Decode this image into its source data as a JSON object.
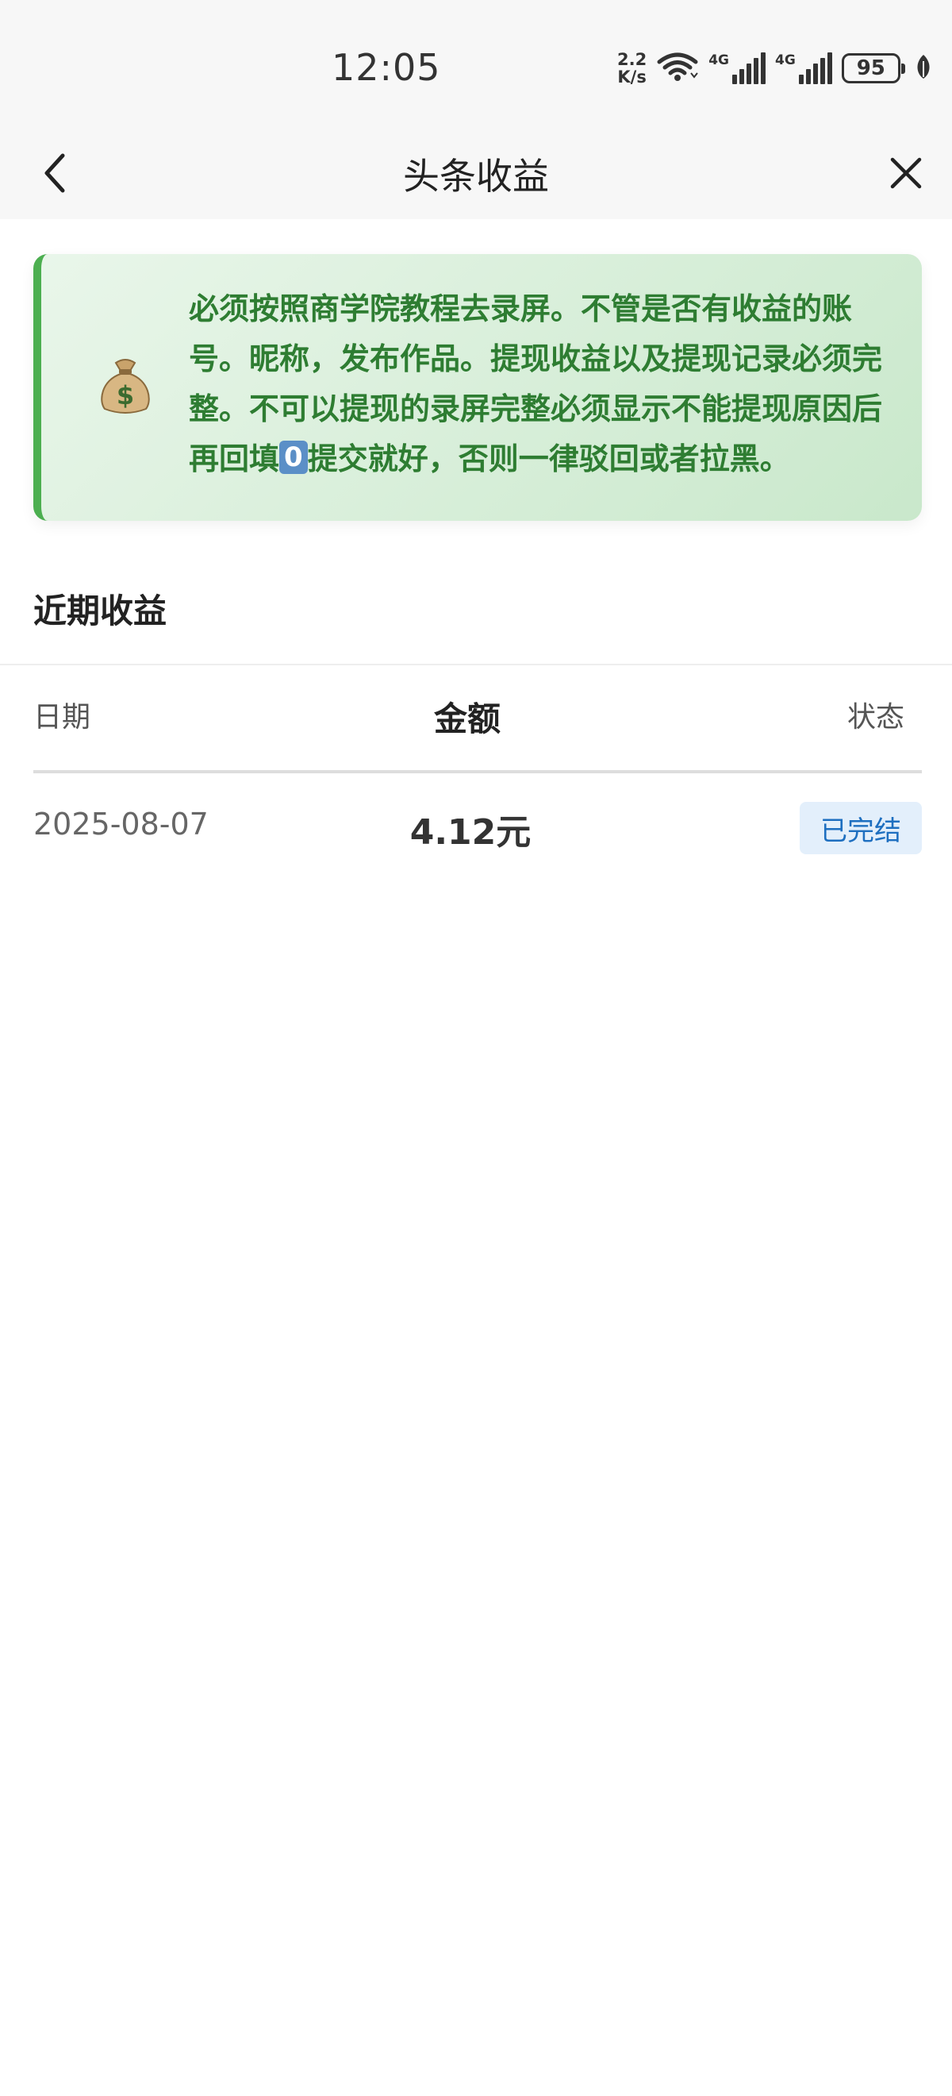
{
  "status_bar": {
    "time": "12:05",
    "net_speed_value": "2.2",
    "net_speed_unit": "K/s",
    "signal_label_1": "4G",
    "signal_label_2": "4G",
    "battery": "95",
    "icons": [
      "wifi-icon",
      "signal-icon",
      "signal-icon",
      "battery-icon",
      "leaf-icon"
    ]
  },
  "nav": {
    "title": "头条收益",
    "back_icon": "chevron-left-icon",
    "close_icon": "close-icon"
  },
  "notice": {
    "icon": "money-bag-icon",
    "text_before": "必须按照商学院教程去录屏。不管是否有收益的账号。昵称，发布作品。提现收益以及提现记录必须完整。不可以提现的录屏完整必须显示不能提现原因后再回填",
    "badge": "0",
    "text_after": "提交就好，否则一律驳回或者拉黑。"
  },
  "section": {
    "title": "近期收益"
  },
  "table": {
    "headers": {
      "date": "日期",
      "amount": "金额",
      "status": "状态"
    },
    "rows": [
      {
        "date": "2025-08-07",
        "amount": "4.12元",
        "status": "已完结"
      }
    ]
  },
  "colors": {
    "notice_accent": "#4caf50",
    "notice_text": "#2e7d32",
    "status_badge_bg": "#e3effb",
    "status_badge_text": "#1e6fc0"
  }
}
